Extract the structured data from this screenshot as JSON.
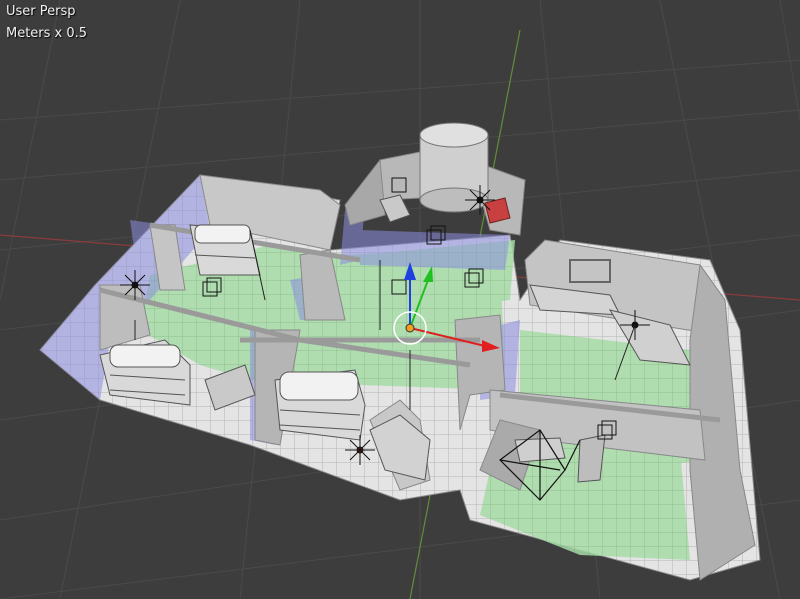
{
  "viewport": {
    "view_name": "User Persp",
    "unit_label": "Meters x 0.5"
  },
  "colors": {
    "background": "#3d3d3d",
    "grid_line": "#4a4a4a",
    "x_axis": "#8a3b3b",
    "y_axis": "#5f8f3a",
    "floor_tile": "#e2e2e2",
    "wall": "#c9c9c9",
    "wall_dark": "#9e9e9e",
    "nav_mesh": "#9fd79f",
    "volume_blue": "#8c8ce0",
    "gizmo_x": "#e02020",
    "gizmo_y": "#20c020",
    "gizmo_z": "#2040e0",
    "origin": "#f0a020"
  },
  "scene_objects": [
    "room-left-bottom",
    "room-left-top",
    "room-center",
    "room-tower",
    "room-right-top",
    "room-right-bottom",
    "bunk-bed-1",
    "bunk-bed-2",
    "bunk-bed-3",
    "crate-1",
    "crate-2",
    "cylinder-tank",
    "red-cube",
    "camera-object",
    "transform-gizmo"
  ]
}
